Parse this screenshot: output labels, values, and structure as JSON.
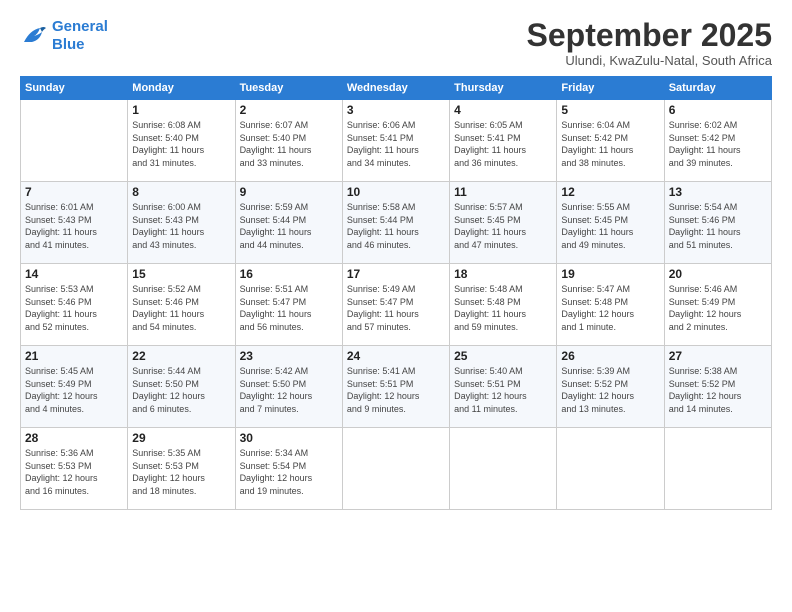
{
  "logo": {
    "line1": "General",
    "line2": "Blue"
  },
  "title": "September 2025",
  "location": "Ulundi, KwaZulu-Natal, South Africa",
  "weekdays": [
    "Sunday",
    "Monday",
    "Tuesday",
    "Wednesday",
    "Thursday",
    "Friday",
    "Saturday"
  ],
  "weeks": [
    [
      {
        "day": "",
        "info": ""
      },
      {
        "day": "1",
        "info": "Sunrise: 6:08 AM\nSunset: 5:40 PM\nDaylight: 11 hours\nand 31 minutes."
      },
      {
        "day": "2",
        "info": "Sunrise: 6:07 AM\nSunset: 5:40 PM\nDaylight: 11 hours\nand 33 minutes."
      },
      {
        "day": "3",
        "info": "Sunrise: 6:06 AM\nSunset: 5:41 PM\nDaylight: 11 hours\nand 34 minutes."
      },
      {
        "day": "4",
        "info": "Sunrise: 6:05 AM\nSunset: 5:41 PM\nDaylight: 11 hours\nand 36 minutes."
      },
      {
        "day": "5",
        "info": "Sunrise: 6:04 AM\nSunset: 5:42 PM\nDaylight: 11 hours\nand 38 minutes."
      },
      {
        "day": "6",
        "info": "Sunrise: 6:02 AM\nSunset: 5:42 PM\nDaylight: 11 hours\nand 39 minutes."
      }
    ],
    [
      {
        "day": "7",
        "info": "Sunrise: 6:01 AM\nSunset: 5:43 PM\nDaylight: 11 hours\nand 41 minutes."
      },
      {
        "day": "8",
        "info": "Sunrise: 6:00 AM\nSunset: 5:43 PM\nDaylight: 11 hours\nand 43 minutes."
      },
      {
        "day": "9",
        "info": "Sunrise: 5:59 AM\nSunset: 5:44 PM\nDaylight: 11 hours\nand 44 minutes."
      },
      {
        "day": "10",
        "info": "Sunrise: 5:58 AM\nSunset: 5:44 PM\nDaylight: 11 hours\nand 46 minutes."
      },
      {
        "day": "11",
        "info": "Sunrise: 5:57 AM\nSunset: 5:45 PM\nDaylight: 11 hours\nand 47 minutes."
      },
      {
        "day": "12",
        "info": "Sunrise: 5:55 AM\nSunset: 5:45 PM\nDaylight: 11 hours\nand 49 minutes."
      },
      {
        "day": "13",
        "info": "Sunrise: 5:54 AM\nSunset: 5:46 PM\nDaylight: 11 hours\nand 51 minutes."
      }
    ],
    [
      {
        "day": "14",
        "info": "Sunrise: 5:53 AM\nSunset: 5:46 PM\nDaylight: 11 hours\nand 52 minutes."
      },
      {
        "day": "15",
        "info": "Sunrise: 5:52 AM\nSunset: 5:46 PM\nDaylight: 11 hours\nand 54 minutes."
      },
      {
        "day": "16",
        "info": "Sunrise: 5:51 AM\nSunset: 5:47 PM\nDaylight: 11 hours\nand 56 minutes."
      },
      {
        "day": "17",
        "info": "Sunrise: 5:49 AM\nSunset: 5:47 PM\nDaylight: 11 hours\nand 57 minutes."
      },
      {
        "day": "18",
        "info": "Sunrise: 5:48 AM\nSunset: 5:48 PM\nDaylight: 11 hours\nand 59 minutes."
      },
      {
        "day": "19",
        "info": "Sunrise: 5:47 AM\nSunset: 5:48 PM\nDaylight: 12 hours\nand 1 minute."
      },
      {
        "day": "20",
        "info": "Sunrise: 5:46 AM\nSunset: 5:49 PM\nDaylight: 12 hours\nand 2 minutes."
      }
    ],
    [
      {
        "day": "21",
        "info": "Sunrise: 5:45 AM\nSunset: 5:49 PM\nDaylight: 12 hours\nand 4 minutes."
      },
      {
        "day": "22",
        "info": "Sunrise: 5:44 AM\nSunset: 5:50 PM\nDaylight: 12 hours\nand 6 minutes."
      },
      {
        "day": "23",
        "info": "Sunrise: 5:42 AM\nSunset: 5:50 PM\nDaylight: 12 hours\nand 7 minutes."
      },
      {
        "day": "24",
        "info": "Sunrise: 5:41 AM\nSunset: 5:51 PM\nDaylight: 12 hours\nand 9 minutes."
      },
      {
        "day": "25",
        "info": "Sunrise: 5:40 AM\nSunset: 5:51 PM\nDaylight: 12 hours\nand 11 minutes."
      },
      {
        "day": "26",
        "info": "Sunrise: 5:39 AM\nSunset: 5:52 PM\nDaylight: 12 hours\nand 13 minutes."
      },
      {
        "day": "27",
        "info": "Sunrise: 5:38 AM\nSunset: 5:52 PM\nDaylight: 12 hours\nand 14 minutes."
      }
    ],
    [
      {
        "day": "28",
        "info": "Sunrise: 5:36 AM\nSunset: 5:53 PM\nDaylight: 12 hours\nand 16 minutes."
      },
      {
        "day": "29",
        "info": "Sunrise: 5:35 AM\nSunset: 5:53 PM\nDaylight: 12 hours\nand 18 minutes."
      },
      {
        "day": "30",
        "info": "Sunrise: 5:34 AM\nSunset: 5:54 PM\nDaylight: 12 hours\nand 19 minutes."
      },
      {
        "day": "",
        "info": ""
      },
      {
        "day": "",
        "info": ""
      },
      {
        "day": "",
        "info": ""
      },
      {
        "day": "",
        "info": ""
      }
    ]
  ]
}
